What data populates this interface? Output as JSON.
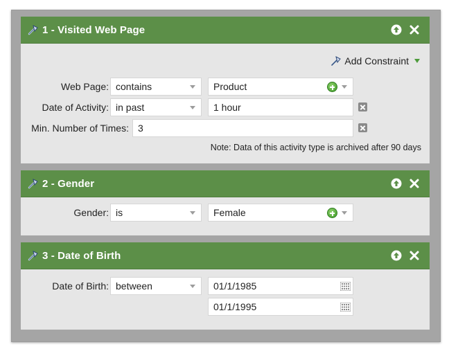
{
  "panels": [
    {
      "title": "1 - Visited Web Page",
      "add_constraint": "Add Constraint",
      "rows": [
        {
          "label": "Web Page:",
          "operator": "contains",
          "value": "Product"
        },
        {
          "label": "Date of Activity:",
          "operator": "in past",
          "value": "1 hour"
        },
        {
          "label": "Min. Number of Times:",
          "value": "3"
        }
      ],
      "note": "Note: Data of this activity type is archived after 90 days"
    },
    {
      "title": "2 - Gender",
      "rows": [
        {
          "label": "Gender:",
          "operator": "is",
          "value": "Female"
        }
      ]
    },
    {
      "title": "3 - Date of Birth",
      "rows": [
        {
          "label": "Date of Birth:",
          "operator": "between",
          "value": "01/1/1985",
          "value2": "01/1/1995"
        }
      ]
    }
  ],
  "icons": {
    "header": [
      "wand-icon",
      "move-up-icon",
      "close-icon"
    ],
    "add": "plus-icon",
    "remove": "remove-icon",
    "calendar": "calendar-icon"
  },
  "colors": {
    "header_green": "#5c8f48",
    "panel_bg": "#e6e6e6",
    "frame_gray": "#a5a5a5"
  }
}
